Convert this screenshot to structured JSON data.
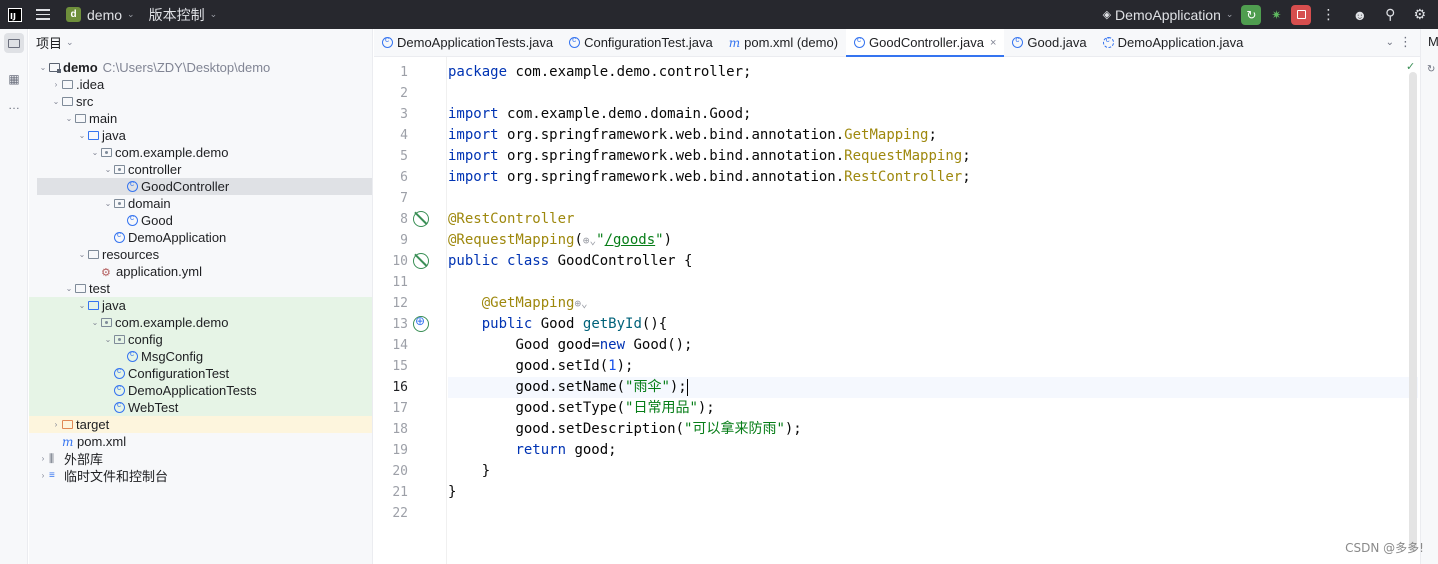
{
  "titlebar": {
    "project_badge": "d",
    "project_name": "demo",
    "vcs_label": "版本控制",
    "run_config": "DemoApplication"
  },
  "project_panel": {
    "title": "项目",
    "tree": [
      {
        "label": "demo",
        "path": "C:\\Users\\ZDY\\Desktop\\demo",
        "indent": 0,
        "arrow": "down",
        "icon": "module",
        "bold": true
      },
      {
        "label": ".idea",
        "indent": 1,
        "arrow": "right",
        "icon": "folder"
      },
      {
        "label": "src",
        "indent": 1,
        "arrow": "down",
        "icon": "folder"
      },
      {
        "label": "main",
        "indent": 2,
        "arrow": "down",
        "icon": "folder"
      },
      {
        "label": "java",
        "indent": 3,
        "arrow": "down",
        "icon": "folder-blue"
      },
      {
        "label": "com.example.demo",
        "indent": 4,
        "arrow": "down",
        "icon": "package"
      },
      {
        "label": "controller",
        "indent": 5,
        "arrow": "down",
        "icon": "package"
      },
      {
        "label": "GoodController",
        "indent": 6,
        "arrow": "",
        "icon": "class",
        "selected": true
      },
      {
        "label": "domain",
        "indent": 5,
        "arrow": "down",
        "icon": "package"
      },
      {
        "label": "Good",
        "indent": 6,
        "arrow": "",
        "icon": "class"
      },
      {
        "label": "DemoApplication",
        "indent": 5,
        "arrow": "",
        "icon": "class"
      },
      {
        "label": "resources",
        "indent": 3,
        "arrow": "down",
        "icon": "folder"
      },
      {
        "label": "application.yml",
        "indent": 4,
        "arrow": "",
        "icon": "yml"
      },
      {
        "label": "test",
        "indent": 2,
        "arrow": "down",
        "icon": "folder"
      },
      {
        "label": "java",
        "indent": 3,
        "arrow": "down",
        "icon": "folder-blue",
        "green": true
      },
      {
        "label": "com.example.demo",
        "indent": 4,
        "arrow": "down",
        "icon": "package",
        "green": true
      },
      {
        "label": "config",
        "indent": 5,
        "arrow": "down",
        "icon": "package",
        "green": true
      },
      {
        "label": "MsgConfig",
        "indent": 6,
        "arrow": "",
        "icon": "class",
        "green": true
      },
      {
        "label": "ConfigurationTest",
        "indent": 5,
        "arrow": "",
        "icon": "class",
        "green": true
      },
      {
        "label": "DemoApplicationTests",
        "indent": 5,
        "arrow": "",
        "icon": "class",
        "green": true
      },
      {
        "label": "WebTest",
        "indent": 5,
        "arrow": "",
        "icon": "class",
        "green": true
      },
      {
        "label": "target",
        "indent": 1,
        "arrow": "right",
        "icon": "folder-orange",
        "yellow": true
      },
      {
        "label": "pom.xml",
        "indent": 1,
        "arrow": "",
        "icon": "maven"
      },
      {
        "label": "外部库",
        "indent": 0,
        "arrow": "right",
        "icon": "lib"
      },
      {
        "label": "临时文件和控制台",
        "indent": 0,
        "arrow": "right",
        "icon": "scratch"
      }
    ]
  },
  "tabs": [
    {
      "label": "DemoApplicationTests.java",
      "icon": "class"
    },
    {
      "label": "ConfigurationTest.java",
      "icon": "class"
    },
    {
      "label": "pom.xml (demo)",
      "icon": "maven"
    },
    {
      "label": "GoodController.java",
      "icon": "class",
      "active": true
    },
    {
      "label": "Good.java",
      "icon": "class"
    },
    {
      "label": "DemoApplication.java",
      "icon": "class-run"
    }
  ],
  "editor": {
    "line_numbers": [
      "1",
      "2",
      "3",
      "4",
      "5",
      "6",
      "7",
      "8",
      "9",
      "10",
      "11",
      "12",
      "13",
      "14",
      "15",
      "16",
      "17",
      "18",
      "19",
      "20",
      "21",
      "22"
    ],
    "current_line": 16,
    "gutter_icons": [
      {
        "line": 8,
        "kind": "bean"
      },
      {
        "line": 10,
        "kind": "bean"
      },
      {
        "line": 13,
        "kind": "web"
      }
    ],
    "lines": [
      [
        {
          "t": "package ",
          "c": "kw"
        },
        {
          "t": "com.example.demo.controller",
          "c": "pkg"
        },
        {
          "t": ";",
          "c": ""
        }
      ],
      [],
      [
        {
          "t": "import ",
          "c": "kw"
        },
        {
          "t": "com.example.demo.domain.",
          "c": "pkg"
        },
        {
          "t": "Good",
          "c": "pkg"
        },
        {
          "t": ";",
          "c": ""
        }
      ],
      [
        {
          "t": "import ",
          "c": "kw"
        },
        {
          "t": "org.springframework.web.bind.annotation.",
          "c": "pkg"
        },
        {
          "t": "GetMapping",
          "c": "ann"
        },
        {
          "t": ";",
          "c": ""
        }
      ],
      [
        {
          "t": "import ",
          "c": "kw"
        },
        {
          "t": "org.springframework.web.bind.annotation.",
          "c": "pkg"
        },
        {
          "t": "RequestMapping",
          "c": "ann"
        },
        {
          "t": ";",
          "c": ""
        }
      ],
      [
        {
          "t": "import ",
          "c": "kw"
        },
        {
          "t": "org.springframework.web.bind.annotation.",
          "c": "pkg"
        },
        {
          "t": "RestController",
          "c": "ann"
        },
        {
          "t": ";",
          "c": ""
        }
      ],
      [],
      [
        {
          "t": "@RestController",
          "c": "ann"
        }
      ],
      [
        {
          "t": "@RequestMapping",
          "c": "ann"
        },
        {
          "t": "(",
          "c": ""
        },
        {
          "t": "⊕⌄",
          "c": "hint"
        },
        {
          "t": "\"",
          "c": "str"
        },
        {
          "t": "/goods",
          "c": "link"
        },
        {
          "t": "\"",
          "c": "str"
        },
        {
          "t": ")",
          "c": ""
        }
      ],
      [
        {
          "t": "public ",
          "c": "kw"
        },
        {
          "t": "class ",
          "c": "kw"
        },
        {
          "t": "GoodController",
          "c": "pkg"
        },
        {
          "t": " {",
          "c": ""
        }
      ],
      [],
      [
        {
          "t": "    ",
          "c": ""
        },
        {
          "t": "@GetMapping",
          "c": "ann"
        },
        {
          "t": "⊕⌄",
          "c": "hint"
        }
      ],
      [
        {
          "t": "    ",
          "c": ""
        },
        {
          "t": "public ",
          "c": "kw"
        },
        {
          "t": "Good ",
          "c": "pkg"
        },
        {
          "t": "getById",
          "c": "mth"
        },
        {
          "t": "(){",
          "c": ""
        }
      ],
      [
        {
          "t": "        ",
          "c": ""
        },
        {
          "t": "Good ",
          "c": "pkg"
        },
        {
          "t": "good",
          "c": "var"
        },
        {
          "t": "=",
          "c": ""
        },
        {
          "t": "new ",
          "c": "kw"
        },
        {
          "t": "Good",
          "c": "pkg"
        },
        {
          "t": "();",
          "c": ""
        }
      ],
      [
        {
          "t": "        ",
          "c": ""
        },
        {
          "t": "good",
          "c": "var"
        },
        {
          "t": ".setId(",
          "c": ""
        },
        {
          "t": "1",
          "c": "num"
        },
        {
          "t": ");",
          "c": ""
        }
      ],
      [
        {
          "t": "        ",
          "c": ""
        },
        {
          "t": "good",
          "c": "var"
        },
        {
          "t": ".setName(",
          "c": ""
        },
        {
          "t": "\"雨伞\"",
          "c": "str"
        },
        {
          "t": ");",
          "c": ""
        },
        {
          "t": "|",
          "c": "caret"
        }
      ],
      [
        {
          "t": "        ",
          "c": ""
        },
        {
          "t": "good",
          "c": "var"
        },
        {
          "t": ".setType(",
          "c": ""
        },
        {
          "t": "\"日常用品\"",
          "c": "str"
        },
        {
          "t": ");",
          "c": ""
        }
      ],
      [
        {
          "t": "        ",
          "c": ""
        },
        {
          "t": "good",
          "c": "var"
        },
        {
          "t": ".setDescription(",
          "c": ""
        },
        {
          "t": "\"可以拿来防雨\"",
          "c": "str"
        },
        {
          "t": ");",
          "c": ""
        }
      ],
      [
        {
          "t": "        ",
          "c": ""
        },
        {
          "t": "return ",
          "c": "kw"
        },
        {
          "t": "good",
          "c": "var"
        },
        {
          "t": ";",
          "c": ""
        }
      ],
      [
        {
          "t": "    }",
          "c": ""
        }
      ],
      [
        {
          "t": "}",
          "c": ""
        }
      ],
      []
    ]
  },
  "right_strip": {
    "label": "M"
  },
  "watermark": "CSDN @多多!"
}
